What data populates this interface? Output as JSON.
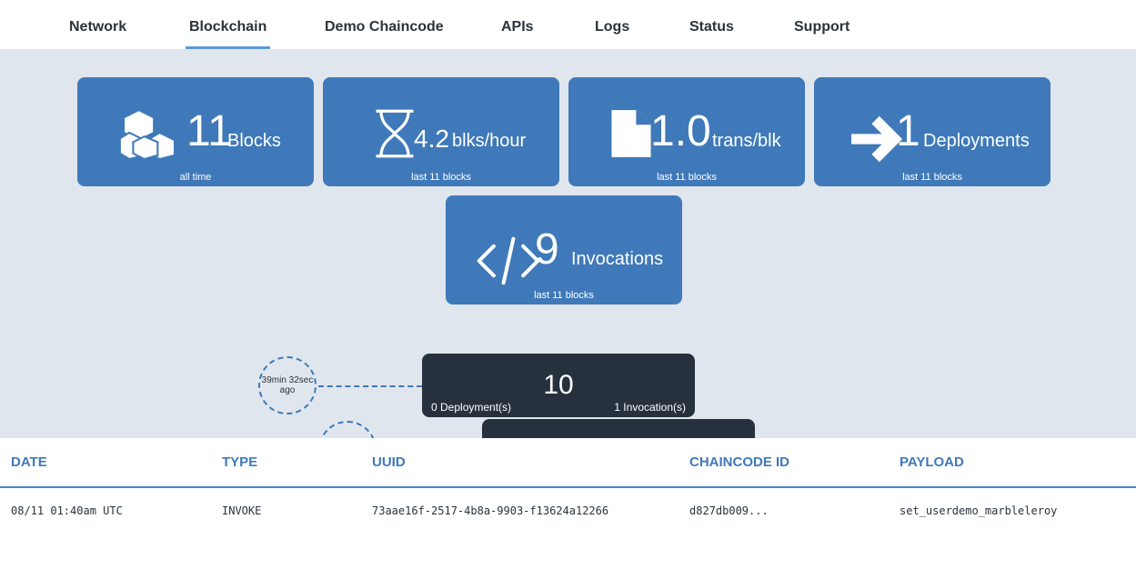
{
  "nav": {
    "items": [
      "Network",
      "Blockchain",
      "Demo Chaincode",
      "APIs",
      "Logs",
      "Status",
      "Support"
    ],
    "active": "Blockchain"
  },
  "stats": {
    "blocks": {
      "value": "11",
      "unit": "Blocks",
      "sub": "all time",
      "icon": "cubes-icon"
    },
    "rate": {
      "value": "4.2",
      "unit": "blks/hour",
      "sub": "last 11 blocks",
      "icon": "hourglass-icon"
    },
    "trans": {
      "value": "1.0",
      "unit": "trans/blk",
      "sub": "last 11 blocks",
      "icon": "file-icon"
    },
    "deployments": {
      "value": "1",
      "unit": "Deployments",
      "sub": "last 11 blocks",
      "icon": "arrow-right-icon"
    },
    "invocations": {
      "value": "9",
      "unit": "Invocations",
      "sub": "last 11 blocks",
      "icon": "code-icon"
    }
  },
  "timeline": {
    "block": {
      "number": "10",
      "time_ago_1": "39min 32sec",
      "time_ago_2": "ago",
      "deployments": "0 Deployment(s)",
      "invocations": "1 Invocation(s)"
    }
  },
  "table": {
    "headers": [
      "DATE",
      "TYPE",
      "UUID",
      "CHAINCODE ID",
      "PAYLOAD"
    ],
    "rows": [
      [
        "08/11 01:40am UTC",
        "INVOKE",
        "73aae16f-2517-4b8a-9903-f13624a12266",
        "d827db009...",
        "set_userdemo_marbleleroy"
      ]
    ]
  },
  "colors": {
    "tile": "#3f79b9",
    "card": "#27313d",
    "accent": "#5c9bd8",
    "background": "#e0e6ed"
  }
}
